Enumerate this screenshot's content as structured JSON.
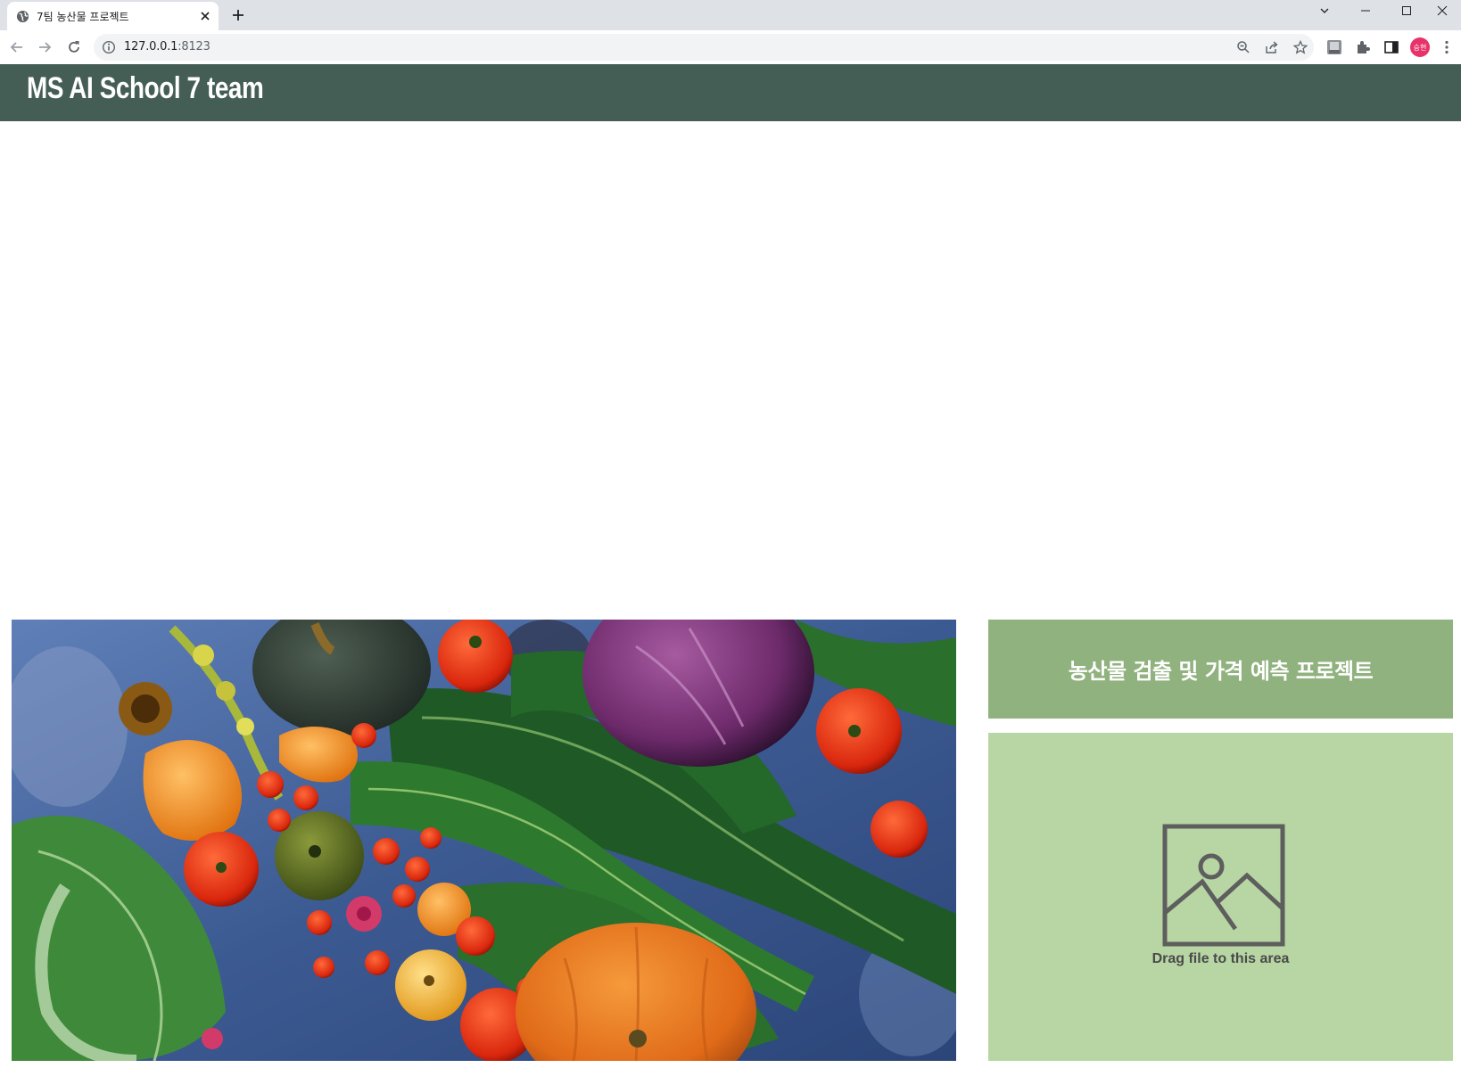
{
  "browser": {
    "tab_title": "7팀 농산물 프로젝트",
    "url_host": "127.0.0.1",
    "url_port": ":8123",
    "profile_initials": "승현"
  },
  "header": {
    "site_title": "MS AI School 7 team"
  },
  "main": {
    "project_title": "농산물 검출 및 가격 예측 프로젝트",
    "hero_image": "vegetables-photo",
    "dropzone": {
      "label": "Drag file to this area",
      "icon": "image-placeholder-icon"
    }
  },
  "colors": {
    "header_bg": "#445e56",
    "title_box_bg": "#90b27e",
    "dropzone_bg": "#b7d6a3"
  }
}
